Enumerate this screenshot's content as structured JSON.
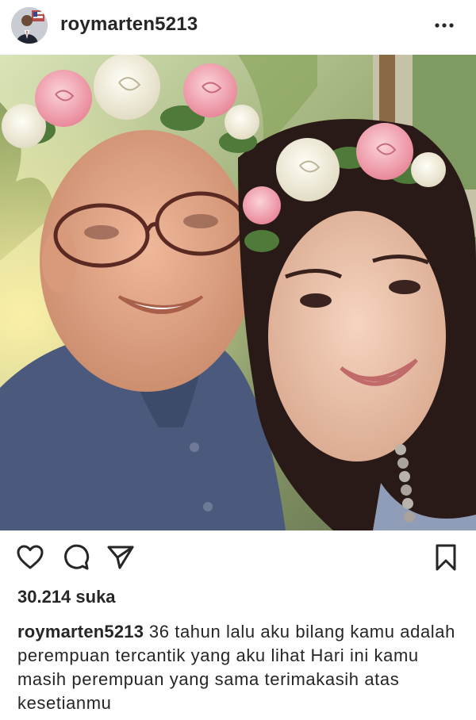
{
  "post": {
    "username": "roymarten5213",
    "likes_text": "30.214 suka",
    "caption_user": "roymarten5213",
    "caption_text": " 36 tahun lalu aku bilang kamu adalah perempuan tercantik yang aku lihat Hari ini kamu masih perempuan yang sama terimakasih atas kesetianmu"
  },
  "icons": {
    "more": "more-dots-icon",
    "like": "heart-icon",
    "comment": "comment-icon",
    "share": "send-icon",
    "save": "bookmark-icon"
  },
  "colors": {
    "text": "#262626",
    "background": "#ffffff"
  }
}
